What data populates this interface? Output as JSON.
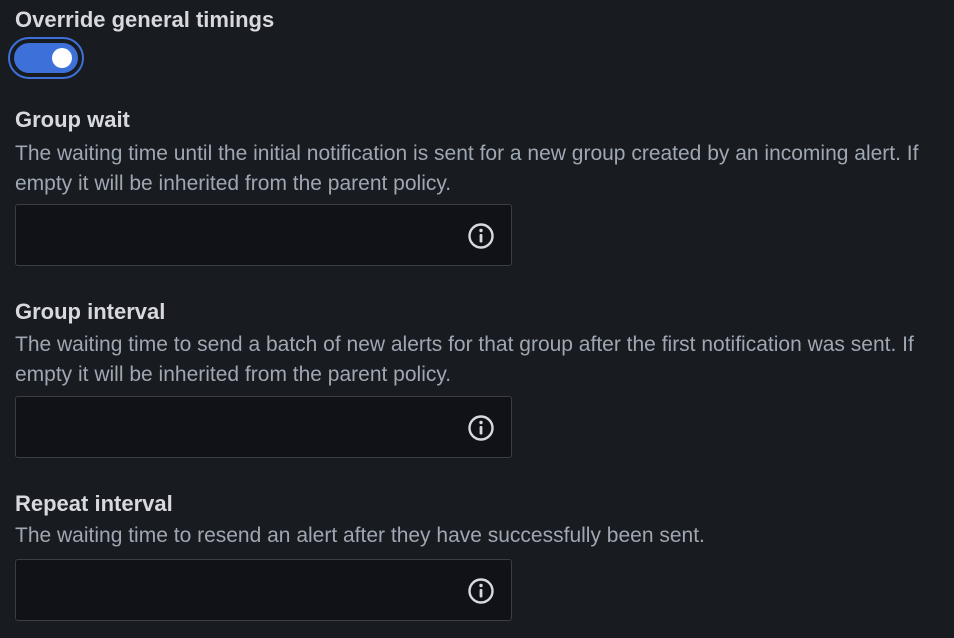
{
  "override": {
    "label": "Override general timings",
    "enabled": true
  },
  "fields": [
    {
      "title": "Group wait",
      "description": "The waiting time until the initial notification is sent for a new group created by an incoming alert. If empty it will be inherited from the parent policy.",
      "value": "",
      "icon": "info-icon"
    },
    {
      "title": "Group interval",
      "description": "The waiting time to send a batch of new alerts for that group after the first notification was sent. If empty it will be inherited from the parent policy.",
      "value": "",
      "icon": "info-icon"
    },
    {
      "title": "Repeat interval",
      "description": "The waiting time to resend an alert after they have successfully been sent.",
      "value": "",
      "icon": "info-icon"
    }
  ],
  "colors": {
    "background": "#181b1f",
    "accent": "#3d71d9",
    "input_background": "#111217",
    "input_border": "#3b3e45"
  }
}
